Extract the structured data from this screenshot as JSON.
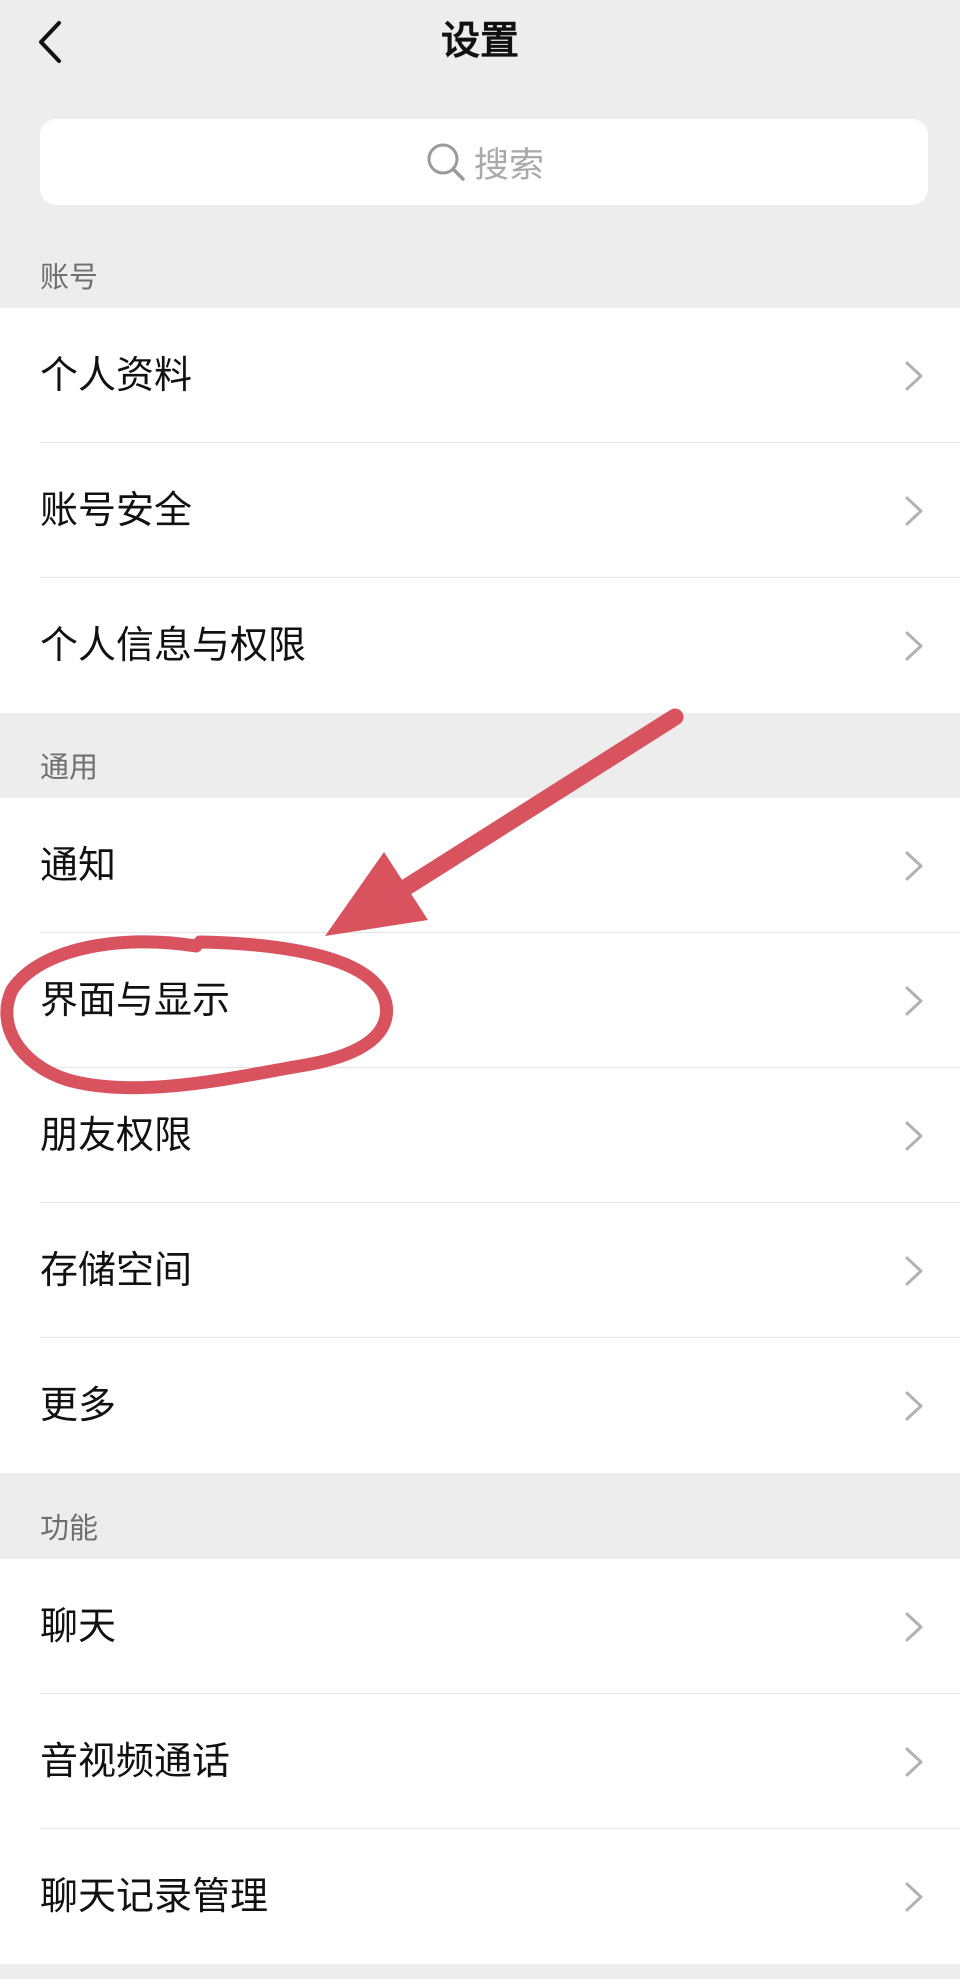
{
  "header": {
    "title": "设置"
  },
  "search": {
    "placeholder": "搜索"
  },
  "sections": [
    {
      "label": "账号",
      "items": [
        "个人资料",
        "账号安全",
        "个人信息与权限"
      ]
    },
    {
      "label": "通用",
      "items": [
        "通知",
        "界面与显示",
        "朋友权限",
        "存储空间",
        "更多"
      ]
    },
    {
      "label": "功能",
      "items": [
        "聊天",
        "音视频通话",
        "聊天记录管理"
      ]
    }
  ],
  "icons": {
    "back": "chevron-left-icon",
    "search": "magnifier-icon",
    "row": "chevron-right-icon"
  },
  "colors": {
    "background": "#ededed",
    "card": "#ffffff",
    "annotation": "#d9535f"
  }
}
